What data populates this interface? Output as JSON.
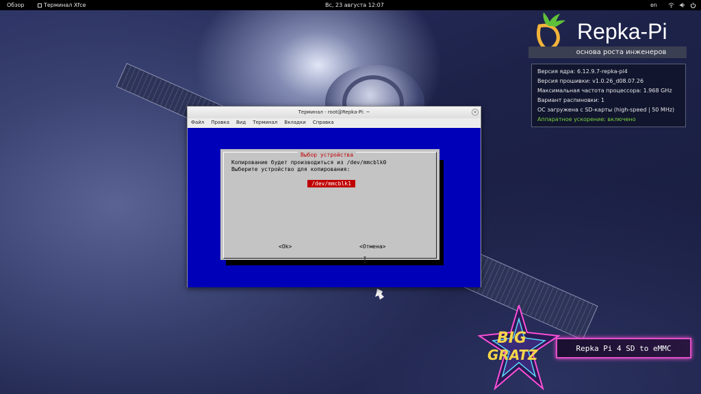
{
  "top_panel": {
    "overview": "Обзор",
    "taskbar_app": "Терминал Xfce",
    "clock": "Вс, 23 августа  12:07",
    "language": "en"
  },
  "branding": {
    "name": "Repka-Pi",
    "tagline": "основа роста инженеров"
  },
  "sysinfo": {
    "kernel": "Версия ядра: 6.12.9.7-repka-pi4",
    "firmware": "Версия прошивки: v1.0.26_d08.07.26",
    "cpu_freq": "Максимальная частота процессора: 1.968 GHz",
    "pinout": "Вариант распиновки: 1",
    "boot": "ОС загружена с SD-карты (high-speed | 50 MHz)",
    "hw_accel": "Аппаратное ускорение: включено"
  },
  "terminal": {
    "title": "Терминал - root@Repka-Pi: ~",
    "menu": [
      "Файл",
      "Правка",
      "Вид",
      "Терминал",
      "Вкладки",
      "Справка"
    ]
  },
  "dialog": {
    "title": "Выбор устройства",
    "line1": "Копирование будет производиться из /dev/mmcblk0",
    "line2": "Выберите устройство для копирования:",
    "selected_device": "/dev/mmcblk1",
    "ok": "<Ok>",
    "cancel": "<Отмена>"
  },
  "badge": {
    "big": "BIG",
    "gratz": "GRATZ",
    "text": "Repka Pi 4 SD to eMMC"
  },
  "colors": {
    "terminal_bg": "#0000b8",
    "dialog_bg": "#c4c4c4",
    "highlight": "#c00000",
    "accel_on": "#7cd33f"
  }
}
